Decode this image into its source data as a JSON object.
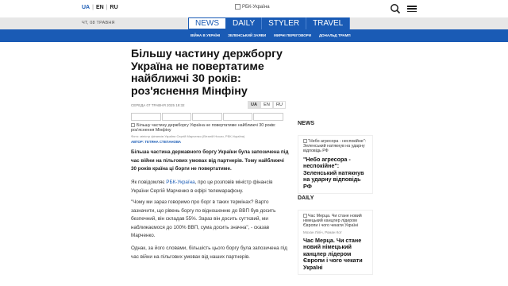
{
  "header": {
    "langs": [
      "UA",
      "EN",
      "RU"
    ],
    "logo_alt": "РБК-Україна",
    "search_icon": "search-icon",
    "menu_icon": "hamburger-menu-icon"
  },
  "nav": {
    "date": "ЧТ, 08 ТРАВНЯ",
    "tabs": [
      "NEWS",
      "DAILY",
      "STYLER",
      "TRAVEL"
    ],
    "sublinks": [
      "ВІЙНА В УКРАЇНІ",
      "ЗЕЛЕНСЬКИЙ ЗАЯВИ",
      "МИРНІ ПЕРЕГОВОРИ",
      "ДОНАЛЬД ТРАМП"
    ]
  },
  "article": {
    "headline": "Більшу частину держборгу Україна не повертатиме найближчі 30 років: роз'яснення Мінфіну",
    "meta": "СЕРЕДА 07 ТРАВНЯ 2025 19:32",
    "lang_switch": [
      "UA",
      "EN",
      "RU"
    ],
    "image_alt": "Більшу частину держборгу Україна не повертатиме найближчі 30 років: роз'яснення Мінфіну",
    "caption": "Фото: міністр фінансів України Сергій Марченко (Віталій Носач, РБК-Україна)",
    "author": "АВТОР: ТЕТЯНА СТЕПАНОВА",
    "lead": "Більша частина державного боргу України була запозичена під час війни на пільгових умовах від партнерів. Тому найближчі 30 років країна ці борги не повертатиме.",
    "p1_before": "Як повідомляє ",
    "p1_link": "РБК-Україна",
    "p1_after": ", про це розповів міністр фінансів України Сергій Марченко в ефірі телемарафону.",
    "p2": "\"Чому ми зараз говоримо про борг в таких термінах? Варто зазначити, що рівень боргу по відношенню до ВВП був досить безпечний, він складав 55%. Зараз він досить суттєвий, ми наближаємося до 100% ВВП, сума досить значна\", - сказав Марченко.",
    "p3": "Однак, за його словами, більшість цього боргу була запозичена під час війни на пільгових умовах від наших партнерів."
  },
  "sidebar": {
    "news_title": "NEWS",
    "news_card": {
      "image_alt": "\"Небо агресора - неспокійне\": Зеленський натякнув на ударну відповідь РФ",
      "title": "\"Небо агресора - неспокійне\": Зеленський натякнув на ударну відповідь РФ"
    },
    "daily_title": "DAILY",
    "daily_card": {
      "image_alt": "Час Мерца. Чи стане новий німецький канцлер лідером Європи і чого чекати Україні",
      "authors": "Мохан Ліліч, Роман Кот",
      "title": "Час Мерца. Чи стане новий німецький канцлер лідером Європи і чого чекати Україні"
    }
  },
  "colors": {
    "accent": "#1a5bb5",
    "nav_bg": "#e7e7e7"
  }
}
